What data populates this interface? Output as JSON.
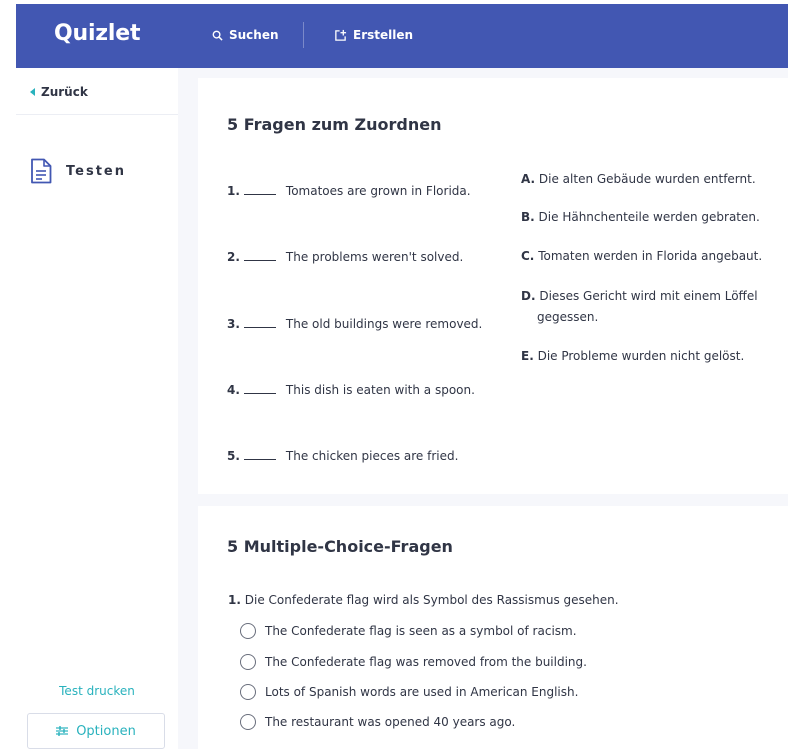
{
  "header": {
    "logo": "Quizlet",
    "search_label": "Suchen",
    "create_label": "Erstellen"
  },
  "sidebar": {
    "back_label": "Zurück",
    "mode_label": "Testen",
    "print_label": "Test drucken",
    "options_label": "Optionen"
  },
  "matching": {
    "title": "5 Fragen zum Zuordnen",
    "questions": [
      {
        "num": "1.",
        "text": "Tomatoes are grown in Florida."
      },
      {
        "num": "2.",
        "text": "The problems weren't solved."
      },
      {
        "num": "3.",
        "text": "The old buildings were removed."
      },
      {
        "num": "4.",
        "text": "This dish is eaten with a spoon."
      },
      {
        "num": "5.",
        "text": "The chicken pieces are fried."
      }
    ],
    "answers": [
      {
        "letter": "A.",
        "text": "Die alten Gebäude wurden entfernt."
      },
      {
        "letter": "B.",
        "text": "Die Hähnchenteile werden gebraten."
      },
      {
        "letter": "C.",
        "text": "Tomaten werden in Florida angebaut."
      },
      {
        "letter": "D.",
        "text": "Dieses Gericht wird mit einem Löffel gegessen."
      },
      {
        "letter": "E.",
        "text": "Die Probleme wurden nicht gelöst."
      }
    ]
  },
  "multiple_choice": {
    "title": "5 Multiple-Choice-Fragen",
    "question": {
      "num": "1.",
      "text": "Die Confederate flag wird als Symbol des Rassismus gesehen."
    },
    "options": [
      "The Confederate flag is seen as a symbol of racism.",
      "The Confederate flag was removed from the building.",
      "Lots of Spanish words are used in American English.",
      "The restaurant was opened 40 years ago."
    ]
  },
  "colors": {
    "header_bg": "#4257b2",
    "accent": "#29b2bd",
    "text": "#303545",
    "page_bg": "#f6f7fb"
  },
  "icons": {
    "search": "search-icon",
    "create": "create-icon",
    "back": "chevron-left-icon",
    "test": "document-icon",
    "options": "sliders-icon"
  }
}
